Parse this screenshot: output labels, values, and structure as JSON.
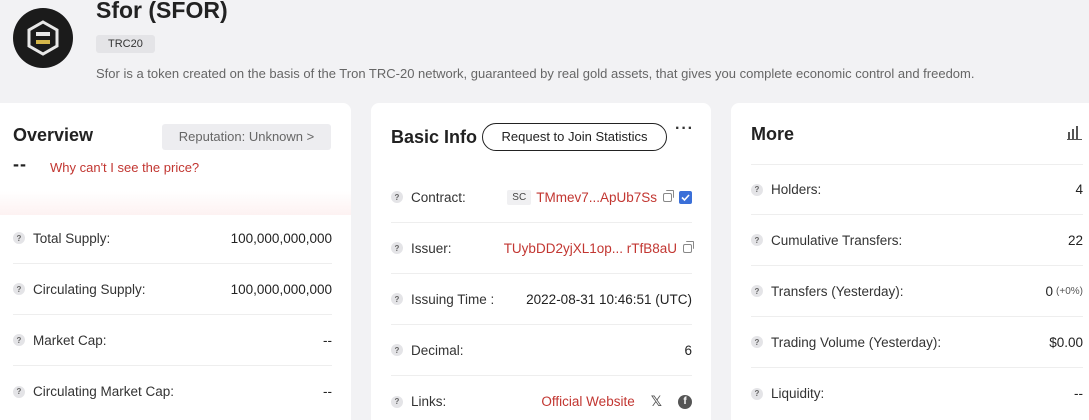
{
  "token": {
    "name": "Sfor (SFOR)",
    "badge": "TRC20",
    "description": "Sfor is a token created on the basis of the Tron TRC-20 network, guaranteed by real gold assets, that gives you complete economic control and freedom."
  },
  "overview": {
    "title": "Overview",
    "reputation_label": "Reputation: Unknown >",
    "price": "--",
    "price_link": "Why can't I see the price?",
    "rows": [
      {
        "label": "Total Supply:",
        "value": "100,000,000,000"
      },
      {
        "label": "Circulating Supply:",
        "value": "100,000,000,000"
      },
      {
        "label": "Market Cap:",
        "value": "--"
      },
      {
        "label": "Circulating Market Cap:",
        "value": "--"
      }
    ]
  },
  "basic_info": {
    "title": "Basic Info",
    "join_label": "Request to Join Statistics",
    "more_label": "···",
    "contract_label": "Contract:",
    "contract_tag": "SC",
    "contract_value": "TMmev7...ApUb7Ss",
    "issuer_label": "Issuer:",
    "issuer_value": "TUybDD2yjXL1op... rTfB8aU",
    "issuing_time_label": "Issuing Time :",
    "issuing_time_value": "2022-08-31 10:46:51 (UTC)",
    "decimal_label": "Decimal:",
    "decimal_value": "6",
    "links_label": "Links:",
    "website_label": "Official Website",
    "x_glyph": "𝕏",
    "fb_glyph": "f"
  },
  "more": {
    "title": "More",
    "rows": [
      {
        "label": "Holders:",
        "value": "4"
      },
      {
        "label": "Cumulative Transfers:",
        "value": "22"
      },
      {
        "label": "Transfers (Yesterday):",
        "value": "0",
        "extra": "(+0%)"
      },
      {
        "label": "Trading Volume (Yesterday):",
        "value": "$0.00"
      },
      {
        "label": "Liquidity:",
        "value": "--"
      }
    ]
  },
  "help_glyph": "?",
  "colors": {
    "accent_red": "#c23631",
    "page_bg": "#f2f2f4",
    "card_bg": "#ffffff"
  }
}
